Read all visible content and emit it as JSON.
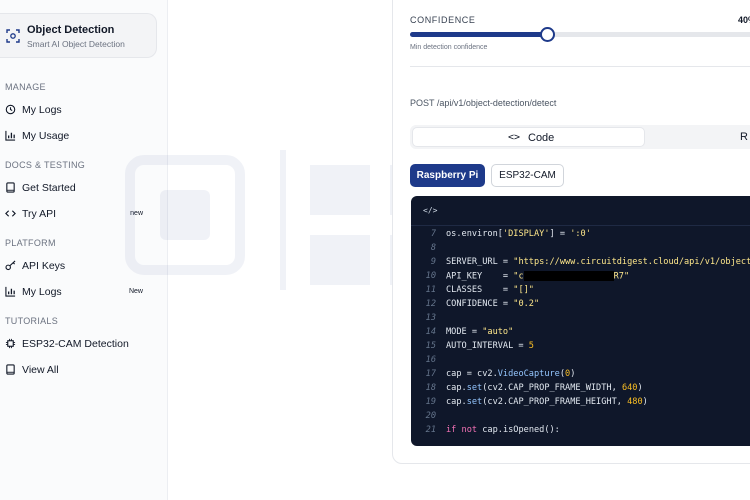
{
  "brand": {
    "title": "Object Detection",
    "subtitle": "Smart AI Object Detection",
    "icon": "scan-icon"
  },
  "sidebar": {
    "sections": [
      {
        "label": "MANAGE",
        "items": [
          {
            "label": "My Logs",
            "icon": "history-icon"
          },
          {
            "label": "My Usage",
            "icon": "chart-icon"
          }
        ]
      },
      {
        "label": "DOCS & TESTING",
        "items": [
          {
            "label": "Get Started",
            "icon": "book-icon"
          },
          {
            "label": "Try API",
            "icon": "code-icon",
            "badge": "new"
          }
        ]
      },
      {
        "label": "PLATFORM",
        "items": [
          {
            "label": "API Keys",
            "icon": "key-icon"
          },
          {
            "label": "My Logs",
            "icon": "history-icon",
            "badge": "New"
          }
        ]
      },
      {
        "label": "TUTORIALS",
        "items": [
          {
            "label": "ESP32-CAM Detection",
            "icon": "chip-icon"
          },
          {
            "label": "View All",
            "icon": "book-icon"
          }
        ]
      }
    ]
  },
  "confidence": {
    "label": "CONFIDENCE",
    "value": "40%",
    "fraction": 0.4,
    "hint": "Min detection confidence"
  },
  "endpoint": "POST /api/v1/object-detection/detect",
  "tabs": {
    "code": "Code",
    "code_icon": "<>",
    "response": "R"
  },
  "platforms": {
    "rpi": "Raspberry Pi",
    "esp": "ESP32-CAM"
  },
  "code": {
    "header_icon": "</>",
    "lines": [
      {
        "n": "7",
        "text": "os.environ['DISPLAY'] = ':0'"
      },
      {
        "n": "8",
        "text": ""
      },
      {
        "n": "9",
        "text": "SERVER_URL = \"https://www.circuitdigest.cloud/api/v1/object"
      },
      {
        "n": "10",
        "text": "API_KEY    = \"c",
        "tail": "R7\""
      },
      {
        "n": "11",
        "text": "CLASSES    = \"[]\""
      },
      {
        "n": "12",
        "text": "CONFIDENCE = \"0.2\""
      },
      {
        "n": "13",
        "text": ""
      },
      {
        "n": "14",
        "text": "MODE = \"auto\""
      },
      {
        "n": "15",
        "text": "AUTO_INTERVAL = 5"
      },
      {
        "n": "16",
        "text": ""
      },
      {
        "n": "17",
        "text": "cap = cv2.VideoCapture(0)"
      },
      {
        "n": "18",
        "text": "cap.set(cv2.CAP_PROP_FRAME_WIDTH, 640)"
      },
      {
        "n": "19",
        "text": "cap.set(cv2.CAP_PROP_FRAME_HEIGHT, 480)"
      },
      {
        "n": "20",
        "text": ""
      },
      {
        "n": "21",
        "text": "if not cap.isOpened():"
      }
    ]
  },
  "colors": {
    "accent": "#1e3a8a",
    "code_bg": "#0f172a"
  }
}
